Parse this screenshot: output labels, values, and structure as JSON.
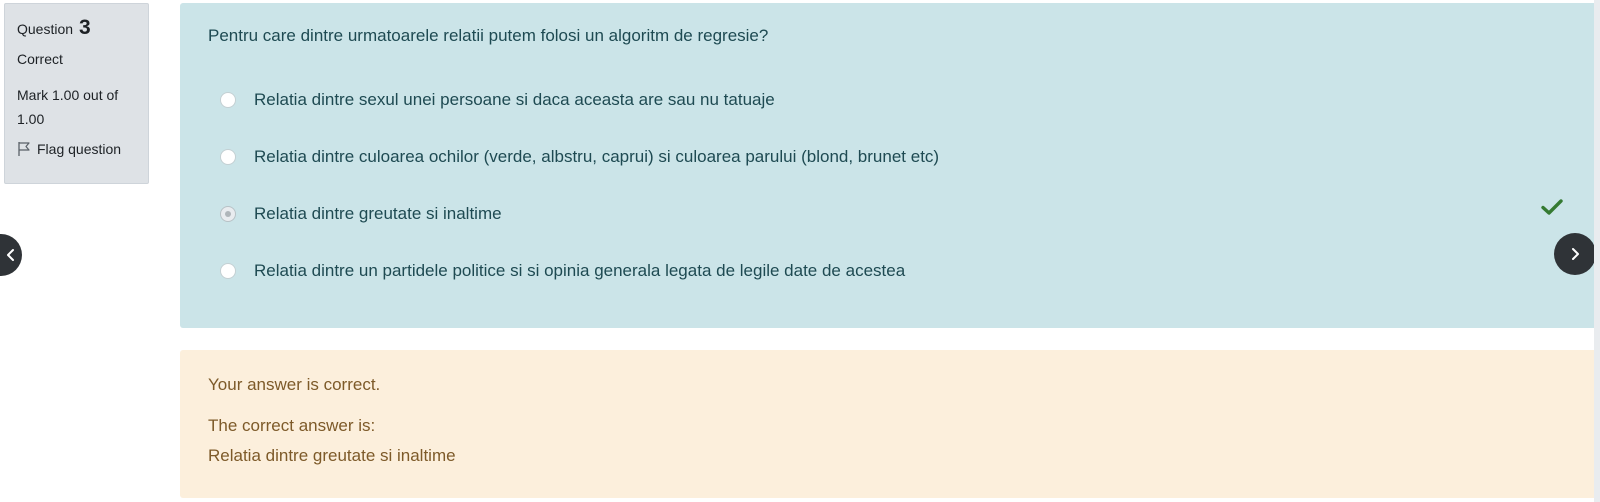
{
  "info": {
    "question_label": "Question",
    "question_number": "3",
    "state": "Correct",
    "grade_line1": "Mark 1.00 out of",
    "grade_line2": "1.00",
    "flag_label": "Flag question"
  },
  "question": {
    "text": "Pentru care dintre urmatoarele relatii putem folosi un algoritm de regresie?",
    "options": [
      {
        "label": "Relatia dintre sexul unei persoane si daca aceasta are sau nu tatuaje",
        "selected": false
      },
      {
        "label": "Relatia dintre culoarea ochilor (verde, albstru, caprui) si culoarea parului (blond, brunet etc)",
        "selected": false
      },
      {
        "label": "Relatia dintre greutate si inaltime",
        "selected": true,
        "correct": true
      },
      {
        "label": "Relatia dintre un partidele politice si si opinia generala legata de legile date de acestea",
        "selected": false
      }
    ]
  },
  "feedback": {
    "general": "Your answer is correct.",
    "right_answer_intro": "The correct answer is:",
    "right_answer": "Relatia dintre greutate si inaltime"
  },
  "navigation": {
    "prev_icon": "chevron-left-icon",
    "next_icon": "chevron-right-icon"
  },
  "colors": {
    "content_bg": "#cbe4e8",
    "feedback_bg": "#fcefdc",
    "info_bg": "#dee2e6",
    "check_green": "#357a32"
  }
}
